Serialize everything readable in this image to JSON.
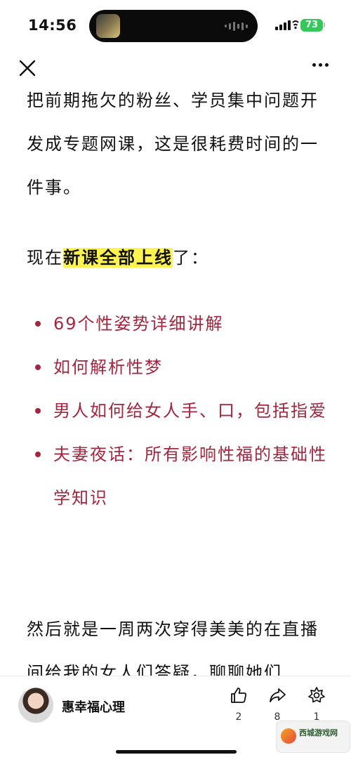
{
  "status_bar": {
    "time": "14:56",
    "battery": "73"
  },
  "article": {
    "para1": "把前期拖欠的粉丝、学员集中问题开发成专题网课，这是很耗费时间的一件事。",
    "para2_prefix": "现在",
    "para2_highlight": "新课全部上线",
    "para2_suffix": "了：",
    "bullets": [
      "69个性姿势详细讲解",
      "如何解析性梦",
      "男人如何给女人手、口，包括指爱",
      "夫妻夜话：所有影响性福的基础性学知识"
    ],
    "para3": "然后就是一周两次穿得美美的在直播间给我的女人们答疑，聊聊她们"
  },
  "bottom_bar": {
    "author_name": "惠幸福心理",
    "like_count": "2",
    "share_count": "8",
    "collect_count": "1"
  },
  "watermark": {
    "text": "西城游戏网"
  },
  "colors": {
    "bullet_text": "#a2263f",
    "highlight": "#fff44d",
    "battery": "#34c759"
  }
}
